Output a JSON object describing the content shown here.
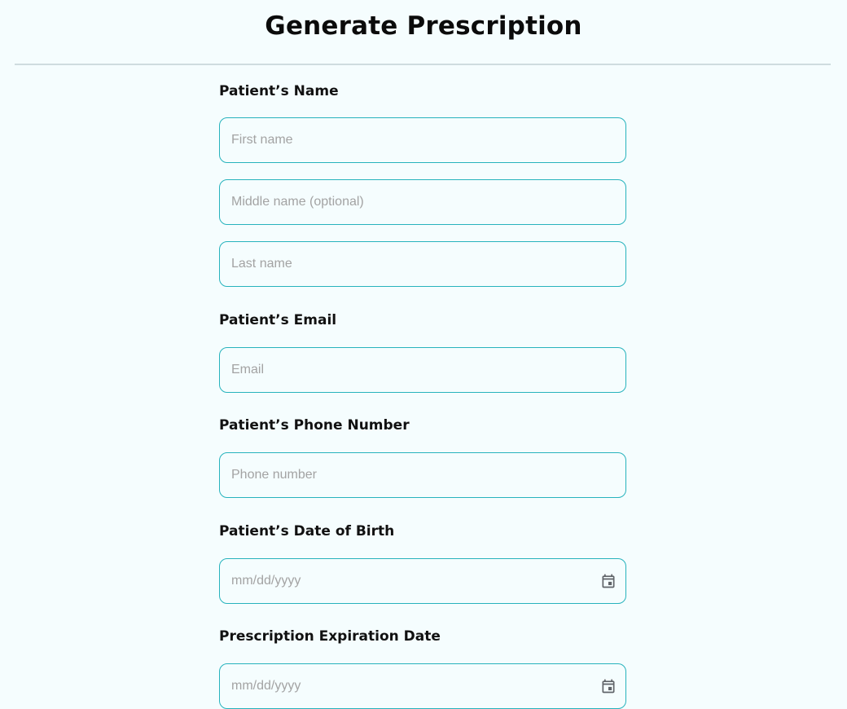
{
  "page": {
    "title": "Generate Prescription"
  },
  "form": {
    "name_section": {
      "label": "Patient’s Name",
      "first_name_placeholder": "First name",
      "middle_name_placeholder": "Middle name (optional)",
      "last_name_placeholder": "Last name"
    },
    "email_section": {
      "label": "Patient’s Email",
      "email_placeholder": "Email"
    },
    "phone_section": {
      "label": "Patient’s Phone Number",
      "phone_placeholder": "Phone number"
    },
    "dob_section": {
      "label": "Patient’s Date of Birth",
      "date_placeholder": "mm/dd/yyyy",
      "icon": "calendar-icon"
    },
    "expiration_section": {
      "label": "Prescription Expiration Date",
      "date_placeholder": "mm/dd/yyyy",
      "icon": "calendar-icon"
    }
  },
  "colors": {
    "background": "#f5fdfe",
    "field_border": "#27b3bd",
    "placeholder": "#a3a3a3",
    "divider": "#cfdcdf"
  }
}
